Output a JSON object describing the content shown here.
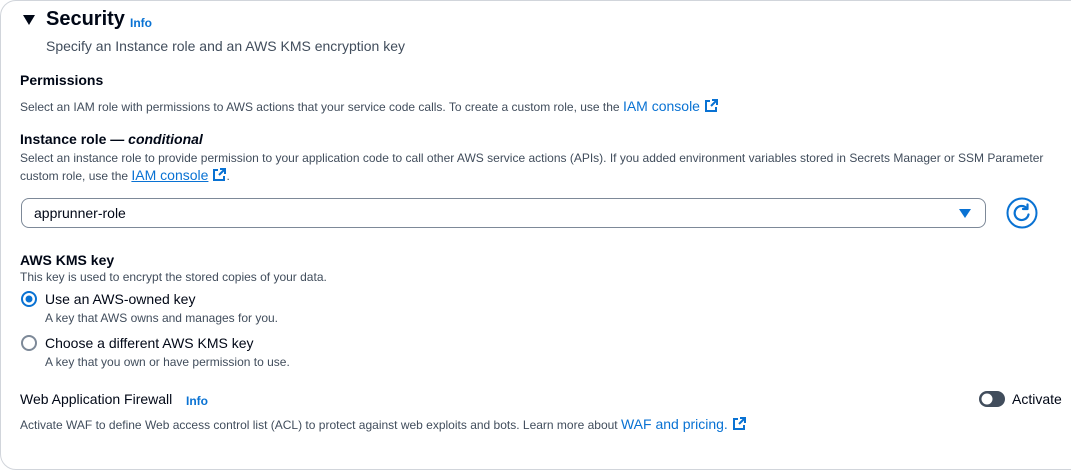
{
  "security": {
    "title": "Security",
    "info": "Info",
    "description": "Specify an Instance role and an AWS KMS encryption key"
  },
  "permissions": {
    "label": "Permissions",
    "description": "Select an IAM role with permissions to AWS actions that your service code calls. To create a custom role, use the ",
    "link": "IAM console"
  },
  "instance_role": {
    "label": "Instance role — ",
    "label_em": "conditional",
    "description_line1": "Select an instance role to provide permission to your application code to call other AWS service actions (APIs). If you added environment variables stored in Secrets Manager or SSM Parameter",
    "description_line2": "custom role, use the ",
    "link": "IAM console",
    "after_link": ".",
    "selected_value": "apprunner-role"
  },
  "kms": {
    "label": "AWS KMS key",
    "description": "This key is used to encrypt the stored copies of your data.",
    "options": [
      {
        "label": "Use an AWS-owned key",
        "description": "A key that AWS owns and manages for you.",
        "selected": true
      },
      {
        "label": "Choose a different AWS KMS key",
        "description": "A key that you own or have permission to use.",
        "selected": false
      }
    ]
  },
  "waf": {
    "label": "Web Application Firewall",
    "info": "Info",
    "description": "Activate WAF to define Web access control list (ACL) to protect against web exploits and bots. Learn more about ",
    "link": "WAF and pricing.",
    "toggle_label": "Activate",
    "toggle_on": false
  },
  "colors": {
    "accent": "#0972d3",
    "text": "#000716",
    "secondary_text": "#414d5c",
    "border": "#7d8998"
  }
}
